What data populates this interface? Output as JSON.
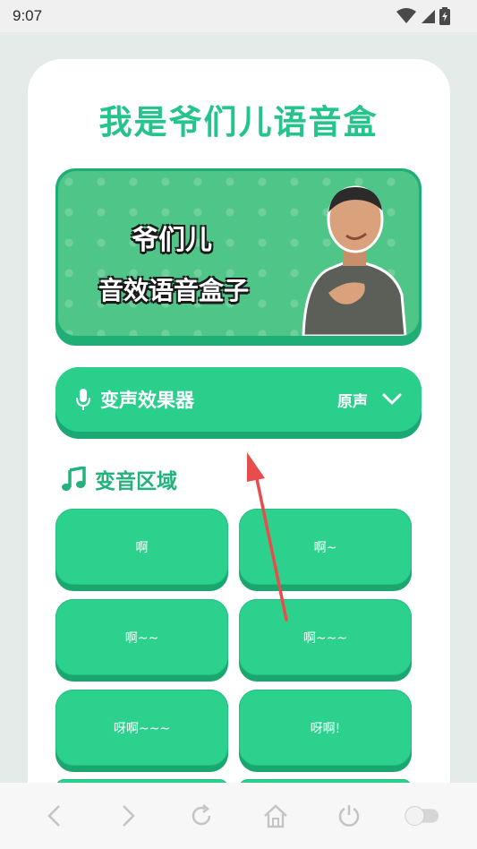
{
  "status_bar": {
    "time": "9:07"
  },
  "page": {
    "title": "我是爷们儿语音盒"
  },
  "banner": {
    "line1": "爷们儿",
    "line2": "音效语音盒子"
  },
  "voice_changer": {
    "label": "变声效果器",
    "value": "原声"
  },
  "section": {
    "title": "变音区域"
  },
  "sounds": [
    "啊",
    "啊~",
    "啊~~",
    "啊~~~",
    "呀啊~~~",
    "呀啊!"
  ],
  "colors": {
    "accent": "#2bd18d",
    "title": "#25c48c",
    "annotation_arrow": "#e84d4d"
  },
  "nav_icons": [
    "back-icon",
    "forward-icon",
    "refresh-icon",
    "home-icon",
    "power-icon",
    "toggle-icon"
  ]
}
